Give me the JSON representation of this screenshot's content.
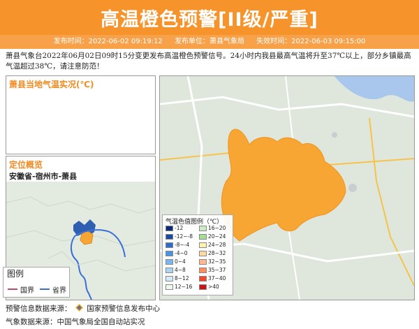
{
  "header": {
    "title": "高温橙色预警[II级/严重]",
    "publish_time": "发布时间：2022-06-02 09:19:12",
    "publisher": "发布单位：萧县气象局",
    "expire_time": "失效时间：2022-06-03 09:15:00"
  },
  "description": "萧县气象台2022年06月02日09时15分变更发布高温橙色预警信号。24小时内我县最高气温将升至37℃以上，部分乡镇最高气温超过38℃，请注意防范！",
  "temp_panel": {
    "title": "萧县当地气温实况(℃)"
  },
  "location_panel": {
    "title": "定位概览",
    "location": "安徽省-宿州市-萧县",
    "legend_title": "图例",
    "legend_items": [
      {
        "label": "国界",
        "color": "#c04868"
      },
      {
        "label": "省界",
        "color": "#3a6fd8"
      }
    ]
  },
  "temp_legend": {
    "title": "气温色值图例（℃）",
    "items": [
      {
        "label": "-12",
        "color": "#0c2a78"
      },
      {
        "label": "-12~-8",
        "color": "#1c4aa0"
      },
      {
        "label": "-8~-4",
        "color": "#2f6cc8"
      },
      {
        "label": "-4~0",
        "color": "#4a93e2"
      },
      {
        "label": "0~4",
        "color": "#78b8f0"
      },
      {
        "label": "4~8",
        "color": "#a8d4f6"
      },
      {
        "label": "8~12",
        "color": "#d2eafa"
      },
      {
        "label": "12~16",
        "color": "#eef8ec"
      },
      {
        "label": "16~20",
        "color": "#c9edc2"
      },
      {
        "label": "20~24",
        "color": "#a2df95"
      },
      {
        "label": "24~28",
        "color": "#fff3b0"
      },
      {
        "label": "28~32",
        "color": "#ffd9a0"
      },
      {
        "label": "32~35",
        "color": "#ffb98c"
      },
      {
        "label": "35~37",
        "color": "#ff8e5c"
      },
      {
        "label": "37~40",
        "color": "#f04a2a"
      },
      {
        "label": ">40",
        "color": "#c8141a"
      }
    ]
  },
  "sources": {
    "warning_source": "预警信息数据来源：",
    "warning_org": "国家预警信息发布中心",
    "weather_source": "气象数据来源：中国气象局全国自动站实况"
  }
}
